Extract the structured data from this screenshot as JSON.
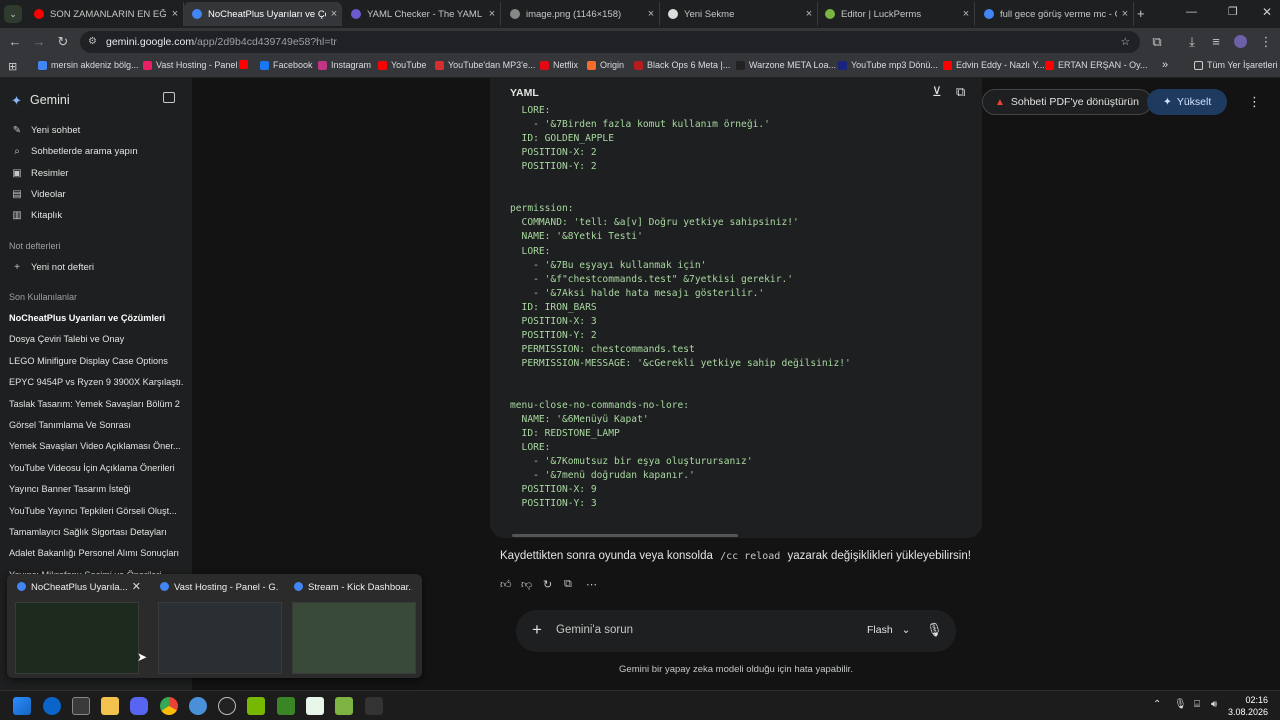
{
  "tabs": [
    {
      "title": "SON ZAMANLARIN EN EĞLENC",
      "color": "#ff0000"
    },
    {
      "title": "NoCheatPlus Uyarıları ve Çözüm",
      "color": "#4285f4",
      "active": true
    },
    {
      "title": "YAML Checker - The YAML Syn",
      "color": "#6a5acd"
    },
    {
      "title": "image.png (1146×158)",
      "color": "#888888"
    },
    {
      "title": "Yeni Sekme",
      "color": "#dddddd"
    },
    {
      "title": "Editor | LuckPerms",
      "color": "#7cb342"
    },
    {
      "title": "full gece görüş verme mc - Go",
      "color": "#4285f4"
    }
  ],
  "url": {
    "host": "gemini.google.com",
    "path": "/app/2d9b4cd439749e58?hl=tr"
  },
  "bookmarks": [
    {
      "label": "mersin akdeniz bölg...",
      "color": "#4285f4"
    },
    {
      "label": "Vast Hosting - Panel",
      "color": "#e91e63"
    },
    {
      "label": "",
      "color": "#ff0000"
    },
    {
      "label": "Facebook",
      "color": "#1877f2"
    },
    {
      "label": "Instagram",
      "color": "#c13584"
    },
    {
      "label": "YouTube",
      "color": "#ff0000"
    },
    {
      "label": "YouTube'dan MP3'e...",
      "color": "#d32f2f"
    },
    {
      "label": "Netflix",
      "color": "#e50914"
    },
    {
      "label": "Origin",
      "color": "#f56c2d"
    },
    {
      "label": "Black Ops 6 Meta |...",
      "color": "#b71c1c"
    },
    {
      "label": "Warzone META Loa...",
      "color": "#222222"
    },
    {
      "label": "YouTube mp3 Dönü...",
      "color": "#1a237e"
    },
    {
      "label": "Edvin Eddy - Nazlı Y...",
      "color": "#ff0000"
    },
    {
      "label": "ERTAN ERŞAN - Oy...",
      "color": "#ff0000"
    }
  ],
  "bookmarks_overflow": "»",
  "bookmarks_all": "Tüm Yer İşaretleri",
  "sidebar": {
    "brand": "Gemini",
    "nav": [
      {
        "label": "Yeni sohbet",
        "icon": "✎"
      },
      {
        "label": "Sohbetlerde arama yapın",
        "icon": "⌕"
      },
      {
        "label": "Resimler",
        "icon": "▣"
      },
      {
        "label": "Videolar",
        "icon": "▤"
      },
      {
        "label": "Kitaplık",
        "icon": "▥"
      }
    ],
    "notebooks_head": "Not defterleri",
    "new_notebook": "Yeni not defteri",
    "recent_head": "Son Kullanılanlar",
    "recent": [
      "NoCheatPlus Uyarıları ve Çözümleri",
      "Dosya Çeviri Talebi ve Onay",
      "LEGO Minifigure Display Case Options",
      "EPYC 9454P vs Ryzen 9 3900X Karşılaştı...",
      "Taslak Tasarım: Yemek Savaşları Bölüm 2",
      "Görsel Tanımlama Ve Sonrası",
      "Yemek Savaşları Video Açıklaması Öner...",
      "YouTube Videosu İçin Açıklama Önerileri",
      "Yayıncı Banner Tasarım İsteği",
      "YouTube Yayıncı Tepkileri Görseli Oluşt...",
      "Tamamlayıcı Sağlık Sigortası Detayları",
      "Adalet Bakanlığı Personel Alımı Sonuçları",
      "Yayıncı Mikrofonu Seçimi ve Önerileri"
    ]
  },
  "code": {
    "label": "YAML",
    "lines": [
      "  LORE:",
      "    - '&7Birden fazla komut kullanım örneği.'",
      "  ID: GOLDEN_APPLE",
      "  POSITION-X: 2",
      "  POSITION-Y: 2",
      "",
      "",
      "permission:",
      "  COMMAND: 'tell: &a[v] Doğru yetkiye sahipsiniz!'",
      "  NAME: '&8Yetki Testi'",
      "  LORE:",
      "    - '&7Bu eşyayı kullanmak için'",
      "    - '&f\"chestcommands.test\" &7yetkisi gerekir.'",
      "    - '&7Aksi halde hata mesajı gösterilir.'",
      "  ID: IRON_BARS",
      "  POSITION-X: 3",
      "  POSITION-Y: 2",
      "  PERMISSION: chestcommands.test",
      "  PERMISSION-MESSAGE: '&cGerekli yetkiye sahip değilsiniz!'",
      "",
      "",
      "menu-close-no-commands-no-lore:",
      "  NAME: '&6Menüyü Kapat'",
      "  ID: REDSTONE_LAMP",
      "  LORE:",
      "    - '&7Komutsuz bir eşya oluşturursanız'",
      "    - '&7menü doğrudan kapanır.'",
      "  POSITION-X: 9",
      "  POSITION-Y: 3"
    ]
  },
  "header": {
    "pdf_button": "Sohbeti PDF'ye dönüştürün",
    "upgrade_button": "Yükselt"
  },
  "answer": {
    "before": "Kaydettikten sonra oyunda veya konsolda",
    "code": "/cc reload",
    "after": "yazarak değişiklikleri yükleyebilirsin!"
  },
  "prompt": {
    "placeholder": "Gemini'a sorun",
    "model": "Flash"
  },
  "disclaimer": "Gemini bir yapay zeka modeli olduğu için hata yapabilir.",
  "thumbnails": [
    {
      "title": "NoCheatPlus Uyarıla..."
    },
    {
      "title": "Vast Hosting - Panel - G..."
    },
    {
      "title": "Stream - Kick Dashboar..."
    }
  ],
  "clock": {
    "time": "02:16",
    "date": "3.08.2026"
  }
}
